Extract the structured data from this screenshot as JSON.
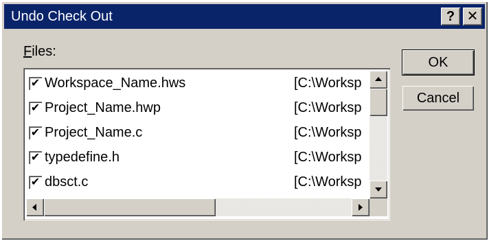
{
  "window": {
    "title": "Undo Check Out",
    "help_label": "?",
    "close_label": "✕"
  },
  "files_label": {
    "mnemonic": "F",
    "rest": "iles:"
  },
  "files": [
    {
      "name": "Workspace_Name.hws",
      "path": "[C:\\Worksp",
      "checked": true
    },
    {
      "name": "Project_Name.hwp",
      "path": "[C:\\Worksp",
      "checked": true
    },
    {
      "name": "Project_Name.c",
      "path": "[C:\\Worksp",
      "checked": true
    },
    {
      "name": "typedefine.h",
      "path": "[C:\\Worksp",
      "checked": true
    },
    {
      "name": "dbsct.c",
      "path": "[C:\\Worksp",
      "checked": true
    }
  ],
  "check_glyph": "✔",
  "buttons": {
    "ok": "OK",
    "cancel": "Cancel"
  }
}
